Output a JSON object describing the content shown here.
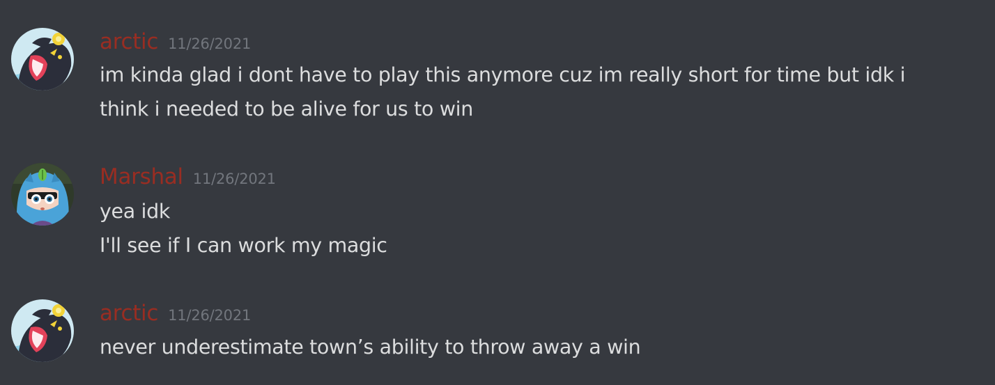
{
  "colors": {
    "background": "#36393f",
    "message_text": "#dcddde",
    "timestamp": "#72767d",
    "username_arctic": "#992d22",
    "username_marshal": "#992d22"
  },
  "messages": [
    {
      "author": "arctic",
      "avatar_icon": "luxray-avatar-icon",
      "timestamp": "11/26/2021",
      "lines": [
        "im kinda glad i dont have to play this anymore cuz im really short for time but idk i",
        "think i needed to be alive for us to win"
      ]
    },
    {
      "author": "Marshal",
      "avatar_icon": "anime-character-avatar-icon",
      "timestamp": "11/26/2021",
      "lines": [
        "yea idk",
        "I'll see if I can work my magic"
      ]
    },
    {
      "author": "arctic",
      "avatar_icon": "luxray-avatar-icon",
      "timestamp": "11/26/2021",
      "lines": [
        "never underestimate town’s ability to throw away a win"
      ]
    }
  ]
}
